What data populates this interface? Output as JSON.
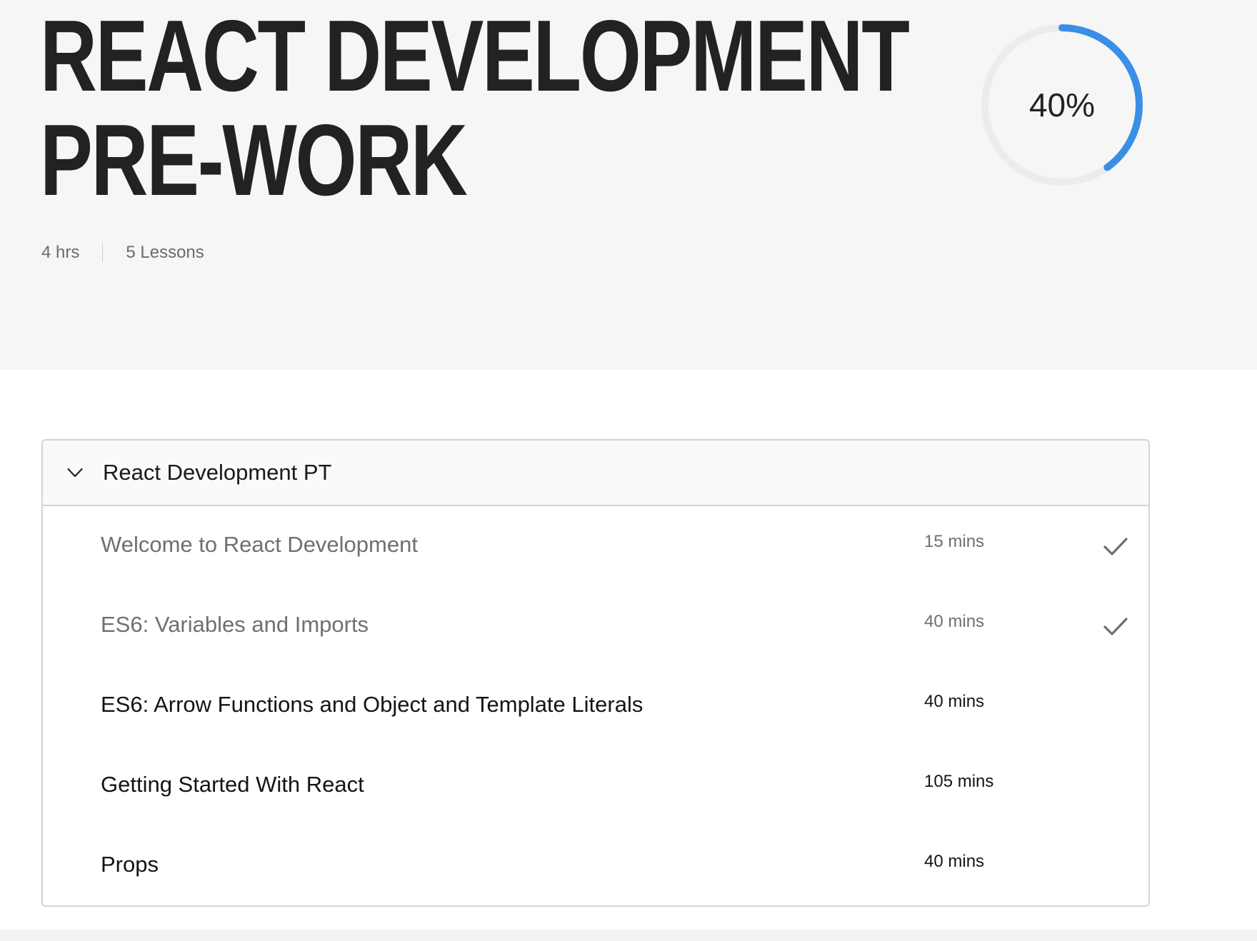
{
  "course": {
    "title_line1": "REACT DEVELOPMENT",
    "title_line2": "PRE-WORK",
    "duration": "4 hrs",
    "lessons_count": "5 Lessons",
    "progress_label": "40%",
    "progress_fraction": 0.4
  },
  "colors": {
    "accent": "#3a8ee6",
    "track": "#ececec",
    "hero_bg": "#f6f6f6"
  },
  "module": {
    "title": "React Development PT",
    "expanded": true,
    "lessons": [
      {
        "title": "Welcome to React Development",
        "duration": "15 mins",
        "completed": true
      },
      {
        "title": "ES6: Variables and Imports",
        "duration": "40 mins",
        "completed": true
      },
      {
        "title": "ES6: Arrow Functions and Object and Template Literals",
        "duration": "40 mins",
        "completed": false
      },
      {
        "title": "Getting Started With React",
        "duration": "105 mins",
        "completed": false
      },
      {
        "title": "Props",
        "duration": "40 mins",
        "completed": false
      }
    ]
  },
  "icons": {
    "chevron": "chevron-down-icon",
    "check": "checkmark-icon"
  }
}
